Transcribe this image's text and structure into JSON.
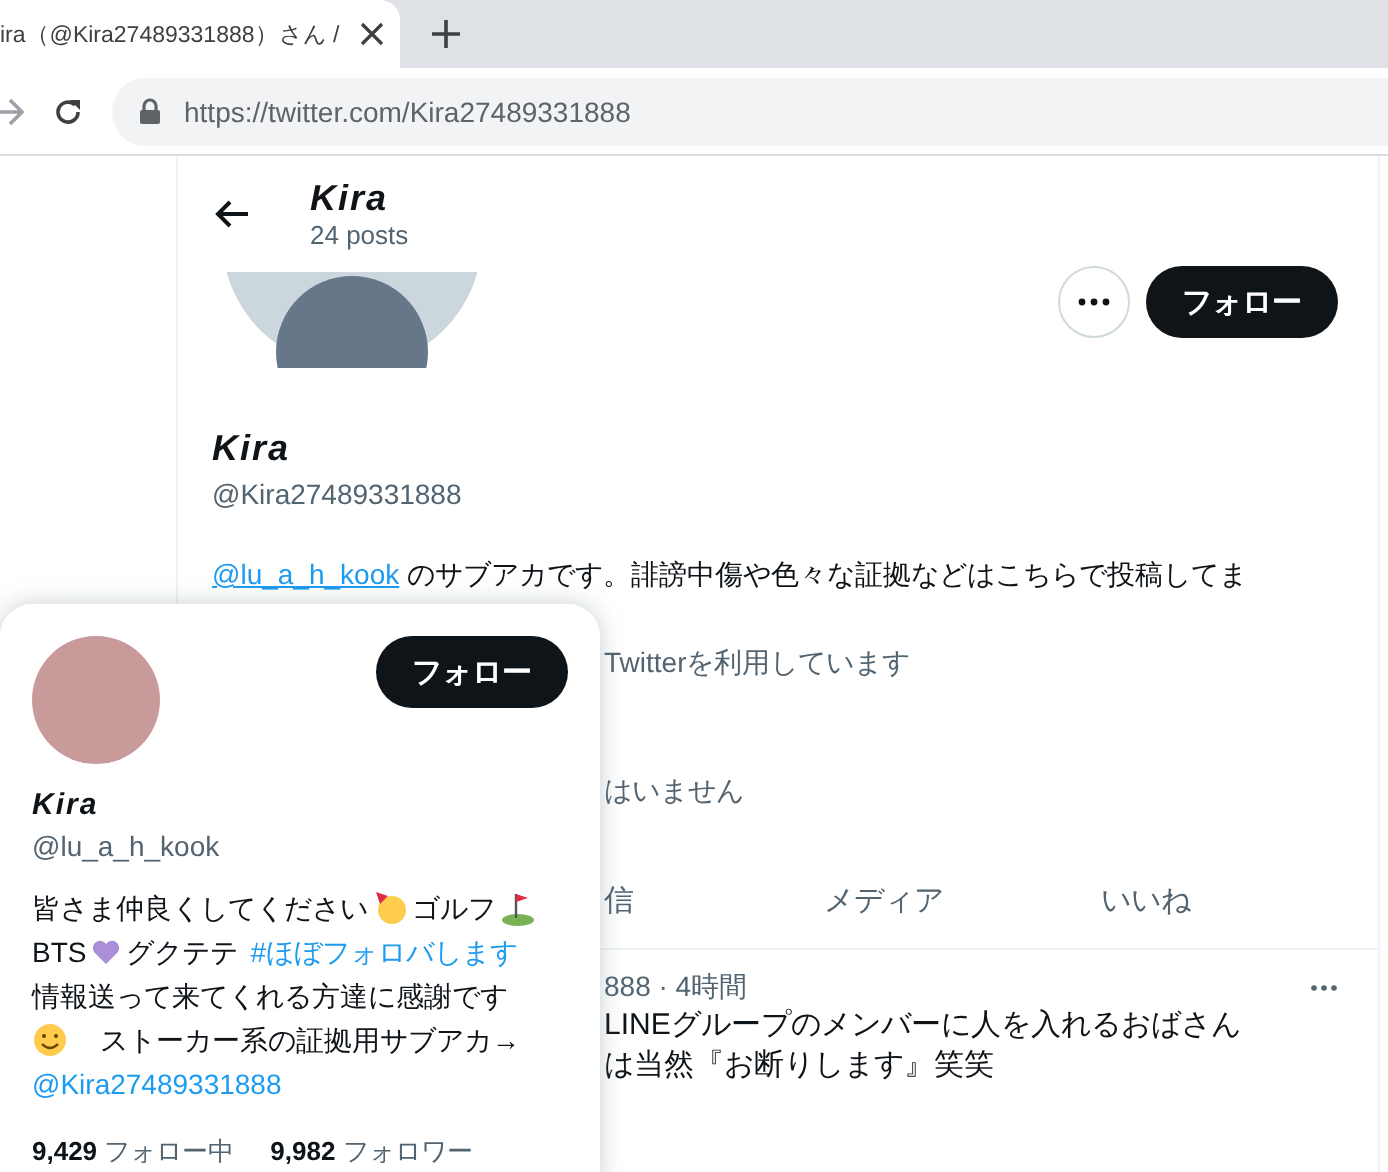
{
  "browser": {
    "tab_title": "ira（@Kira27489331888）さん /",
    "url": "https://twitter.com/Kira27489331888"
  },
  "header": {
    "name": "Kira",
    "posts": "24 posts"
  },
  "profile": {
    "follow_label": "フォロー",
    "name": "Kira",
    "handle": "@Kira27489331888",
    "bio_mention": "@lu_a_h_kook",
    "bio_text": " のサブアカです。誹謗中傷や色々な証拠などはこちらで投稿してま",
    "line_1": "Twitterを利用しています",
    "line_2": "はいません"
  },
  "tabs": [
    {
      "label": "信"
    },
    {
      "label": "メディア"
    },
    {
      "label": "いいね"
    }
  ],
  "tweet": {
    "meta": "888 · 4時間",
    "lines": [
      "LINEグループのメンバーに人を入れるおばさん",
      "は当然『お断りします』笑笑"
    ]
  },
  "hover_card": {
    "follow_label": "フォロー",
    "name": "Kira",
    "handle": "@lu_a_h_kook",
    "bio_lines": [
      [
        {
          "kind": "text",
          "text": "皆さま仲良くしてください"
        },
        {
          "kind": "party"
        },
        {
          "kind": "text",
          "text": "ゴルフ"
        },
        {
          "kind": "golf"
        }
      ],
      [
        {
          "kind": "text",
          "text": "BTS"
        },
        {
          "kind": "heart"
        },
        {
          "kind": "text",
          "text": "グクテテ"
        },
        {
          "kind": "hashtag",
          "text": "#ほぼフォロバします"
        }
      ],
      [
        {
          "kind": "text",
          "text": "情報送って来てくれる方達に感謝です"
        }
      ],
      [
        {
          "kind": "smile"
        },
        {
          "kind": "text",
          "text": "ストーカー系の証拠用サブアカ→"
        }
      ],
      [
        {
          "kind": "mention",
          "text": "@Kira27489331888"
        }
      ]
    ],
    "stats": [
      {
        "count": "9,429",
        "label": "フォロー中"
      },
      {
        "count": "9,982",
        "label": "フォロワー"
      }
    ]
  }
}
